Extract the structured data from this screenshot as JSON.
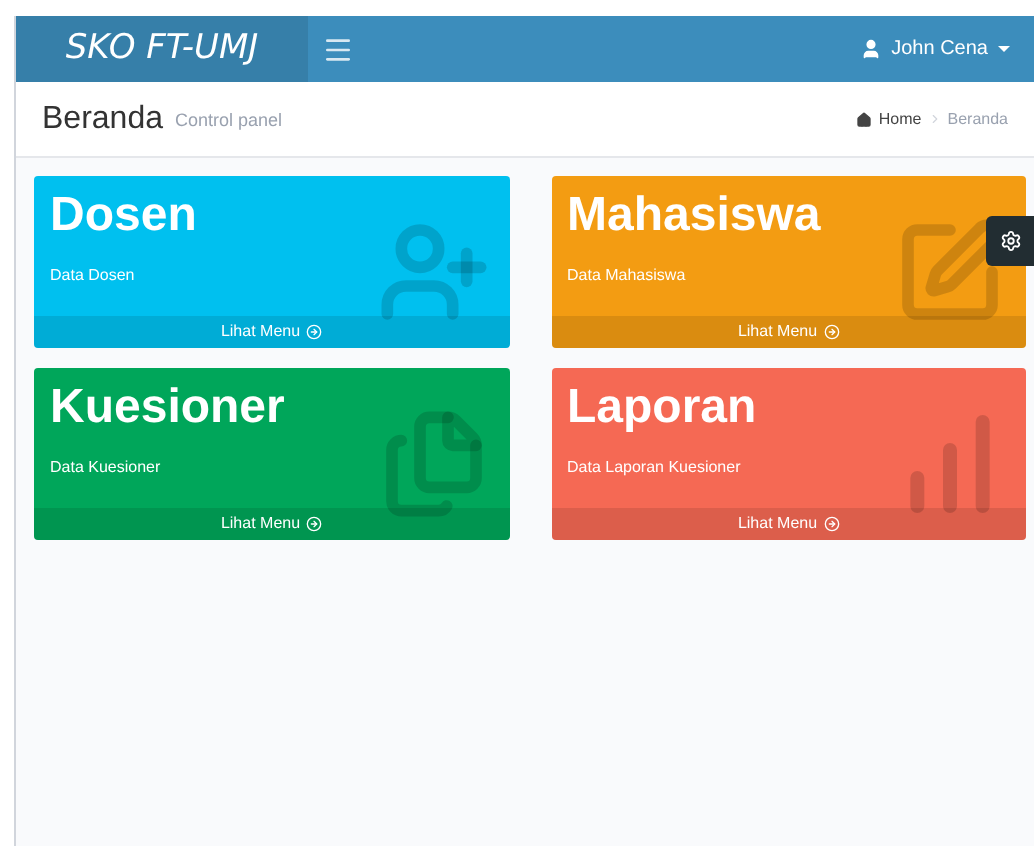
{
  "header": {
    "logo": "SKO FT-UMJ",
    "user": "John Cena"
  },
  "page": {
    "title": "Beranda",
    "subtitle": "Control panel",
    "breadcrumb": [
      {
        "label": "Home",
        "kind": "home"
      },
      {
        "label": "Beranda",
        "kind": "current"
      }
    ]
  },
  "boxes": [
    {
      "title": "Dosen",
      "text": "Data Dosen",
      "link": "Lihat Menu",
      "color": "#00c0ef",
      "kind": "user"
    },
    {
      "title": "Mahasiswa",
      "text": "Data Mahasiswa",
      "link": "Lihat Menu",
      "color": "#f39c12",
      "kind": "edit"
    },
    {
      "title": "Kuesioner",
      "text": "Data Kuesioner",
      "link": "Lihat Menu",
      "color": "#00a65a",
      "kind": "copy"
    },
    {
      "title": "Laporan",
      "text": "Data Laporan Kuesioner",
      "link": "Lihat Menu",
      "color": "#f56954",
      "kind": "chart"
    }
  ]
}
